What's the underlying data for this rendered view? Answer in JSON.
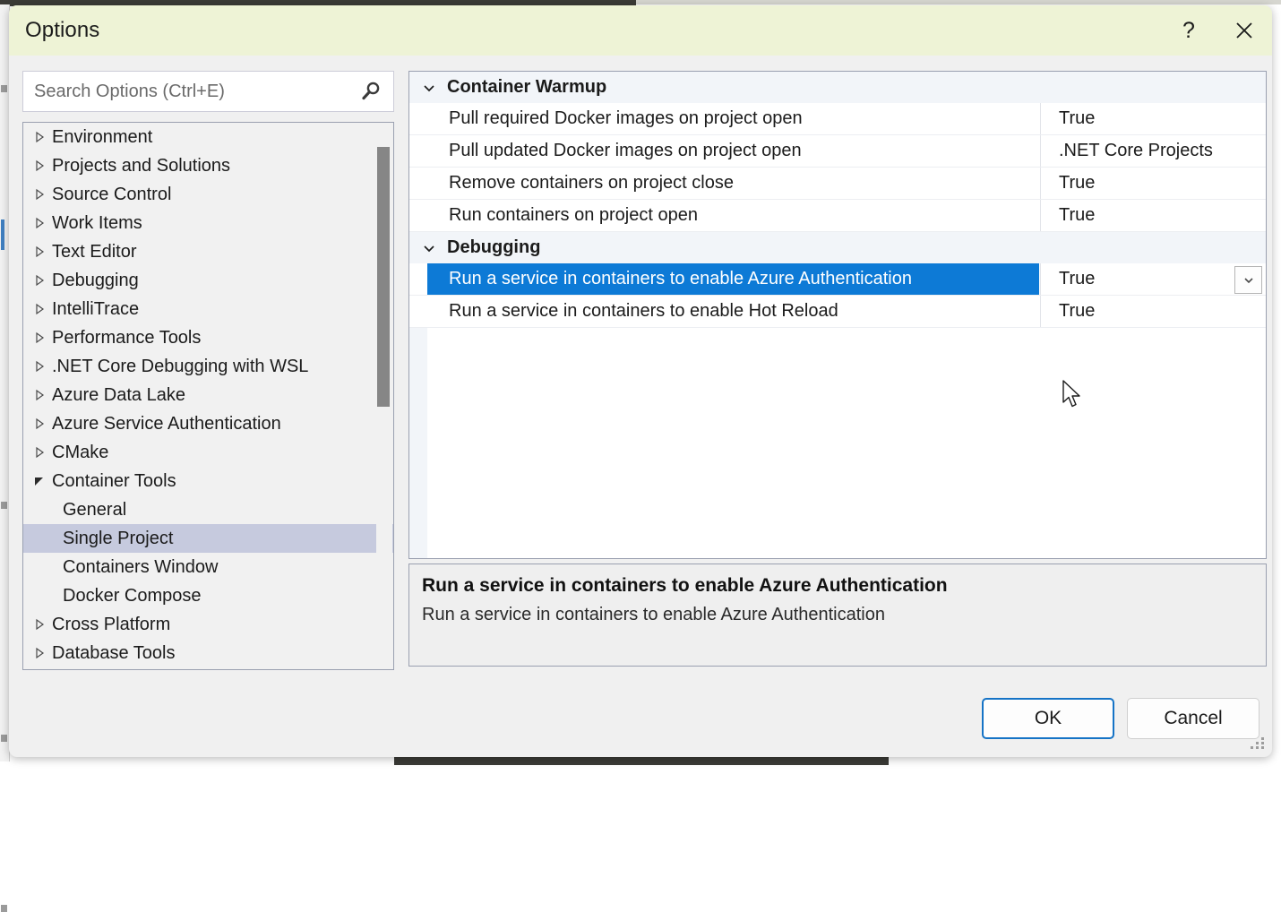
{
  "window": {
    "title": "Options",
    "help_icon": "question-mark-icon",
    "close_icon": "close-icon"
  },
  "search": {
    "placeholder": "Search Options (Ctrl+E)",
    "value": "",
    "icon": "search-icon"
  },
  "tree": {
    "items": [
      {
        "label": "Environment",
        "level": 0,
        "state": "collapsed",
        "selected": false
      },
      {
        "label": "Projects and Solutions",
        "level": 0,
        "state": "collapsed",
        "selected": false
      },
      {
        "label": "Source Control",
        "level": 0,
        "state": "collapsed",
        "selected": false
      },
      {
        "label": "Work Items",
        "level": 0,
        "state": "collapsed",
        "selected": false
      },
      {
        "label": "Text Editor",
        "level": 0,
        "state": "collapsed",
        "selected": false
      },
      {
        "label": "Debugging",
        "level": 0,
        "state": "collapsed",
        "selected": false
      },
      {
        "label": "IntelliTrace",
        "level": 0,
        "state": "collapsed",
        "selected": false
      },
      {
        "label": "Performance Tools",
        "level": 0,
        "state": "collapsed",
        "selected": false
      },
      {
        "label": ".NET Core Debugging with WSL",
        "level": 0,
        "state": "collapsed",
        "selected": false
      },
      {
        "label": "Azure Data Lake",
        "level": 0,
        "state": "collapsed",
        "selected": false
      },
      {
        "label": "Azure Service Authentication",
        "level": 0,
        "state": "collapsed",
        "selected": false
      },
      {
        "label": "CMake",
        "level": 0,
        "state": "collapsed",
        "selected": false
      },
      {
        "label": "Container Tools",
        "level": 0,
        "state": "expanded",
        "selected": false
      },
      {
        "label": "General",
        "level": 1,
        "state": "leaf",
        "selected": false
      },
      {
        "label": "Single Project",
        "level": 1,
        "state": "leaf",
        "selected": true
      },
      {
        "label": "Containers Window",
        "level": 1,
        "state": "leaf",
        "selected": false
      },
      {
        "label": "Docker Compose",
        "level": 1,
        "state": "leaf",
        "selected": false
      },
      {
        "label": "Cross Platform",
        "level": 0,
        "state": "collapsed",
        "selected": false
      },
      {
        "label": "Database Tools",
        "level": 0,
        "state": "collapsed",
        "selected": false
      }
    ]
  },
  "grid": {
    "rows": [
      {
        "kind": "category",
        "label": "Container Warmup",
        "state": "expanded"
      },
      {
        "kind": "property",
        "label": "Pull required Docker images on project open",
        "value": "True",
        "selected": false,
        "has_dropdown": false
      },
      {
        "kind": "property",
        "label": "Pull updated Docker images on project open",
        "value": ".NET Core Projects",
        "selected": false,
        "has_dropdown": false
      },
      {
        "kind": "property",
        "label": "Remove containers on project close",
        "value": "True",
        "selected": false,
        "has_dropdown": false
      },
      {
        "kind": "property",
        "label": "Run containers on project open",
        "value": "True",
        "selected": false,
        "has_dropdown": false
      },
      {
        "kind": "category",
        "label": "Debugging",
        "state": "expanded"
      },
      {
        "kind": "property",
        "label": "Run a service in containers to enable Azure Authentication",
        "value": "True",
        "selected": true,
        "has_dropdown": true
      },
      {
        "kind": "property",
        "label": "Run a service in containers to enable Hot Reload",
        "value": "True",
        "selected": false,
        "has_dropdown": false
      }
    ]
  },
  "description": {
    "title": "Run a service in containers to enable Azure Authentication",
    "body": "Run a service in containers to enable Azure Authentication"
  },
  "footer": {
    "ok_label": "OK",
    "cancel_label": "Cancel"
  },
  "colors": {
    "titlebar": "#EEF3D6",
    "dialog_body": "#F0F0F0",
    "selection_blue": "#0D7AD6",
    "tree_selection": "#C6CADE",
    "category_band": "#F2F5F9",
    "default_button_border": "#1573C6"
  }
}
